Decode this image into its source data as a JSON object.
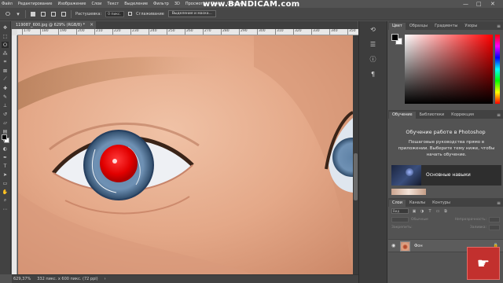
{
  "menubar": {
    "items": [
      "Файл",
      "Редактирование",
      "Изображение",
      "Слои",
      "Текст",
      "Выделение",
      "Фильтр",
      "3D",
      "Просмотр",
      "Окно",
      "Справка"
    ],
    "watermark": "www.BANDICAM.com",
    "window_controls": [
      "—",
      "□",
      "✕"
    ]
  },
  "options_bar": {
    "feather_label": "Растушевка:",
    "feather_value": "0 пикс.",
    "smoothing_label": "Сглаживание",
    "select_mask_button": "Выделение и маска..."
  },
  "document": {
    "tab_title": "119087_600.jpg @ 629% (RGB/8) *",
    "close_glyph": "×",
    "ruler_ticks": [
      "170",
      "180",
      "190",
      "200",
      "210",
      "220",
      "230",
      "240",
      "250",
      "260",
      "270",
      "280",
      "290",
      "300",
      "310",
      "320",
      "330",
      "340",
      "350"
    ]
  },
  "status_bar": {
    "zoom": "629,37%",
    "doc_info": "332 пикс. x 600 пикс. (72 ppi)",
    "arrow": "›"
  },
  "color_panel": {
    "tabs": [
      "Цвет",
      "Образцы",
      "Градиенты",
      "Узоры"
    ],
    "active_tab": 0,
    "menu_glyph": "≡",
    "foreground": "#000000",
    "background": "#ffffff",
    "picker_hue": "#ff0000"
  },
  "learn_panel": {
    "tabs": [
      "Обучение",
      "Библиотеки",
      "Коррекция"
    ],
    "active_tab": 0,
    "menu_glyph": "≡",
    "title": "Обучение работе в Photoshop",
    "description": "Пошаговые руководства прямо в приложении. Выберите тему ниже, чтобы начать обучение.",
    "card_label": "Основные навыки"
  },
  "layers_panel": {
    "tabs": [
      "Слои",
      "Каналы",
      "Контуры"
    ],
    "active_tab": 0,
    "menu_glyph": "≡",
    "search_placeholder": "Вид",
    "mode_label": "Обычные",
    "opacity_label": "Непрозрачность:",
    "fill_label": "Заливка:",
    "lock_label": "Закрепить:",
    "layer_name": "Фон",
    "lock_glyph": "🔒"
  }
}
